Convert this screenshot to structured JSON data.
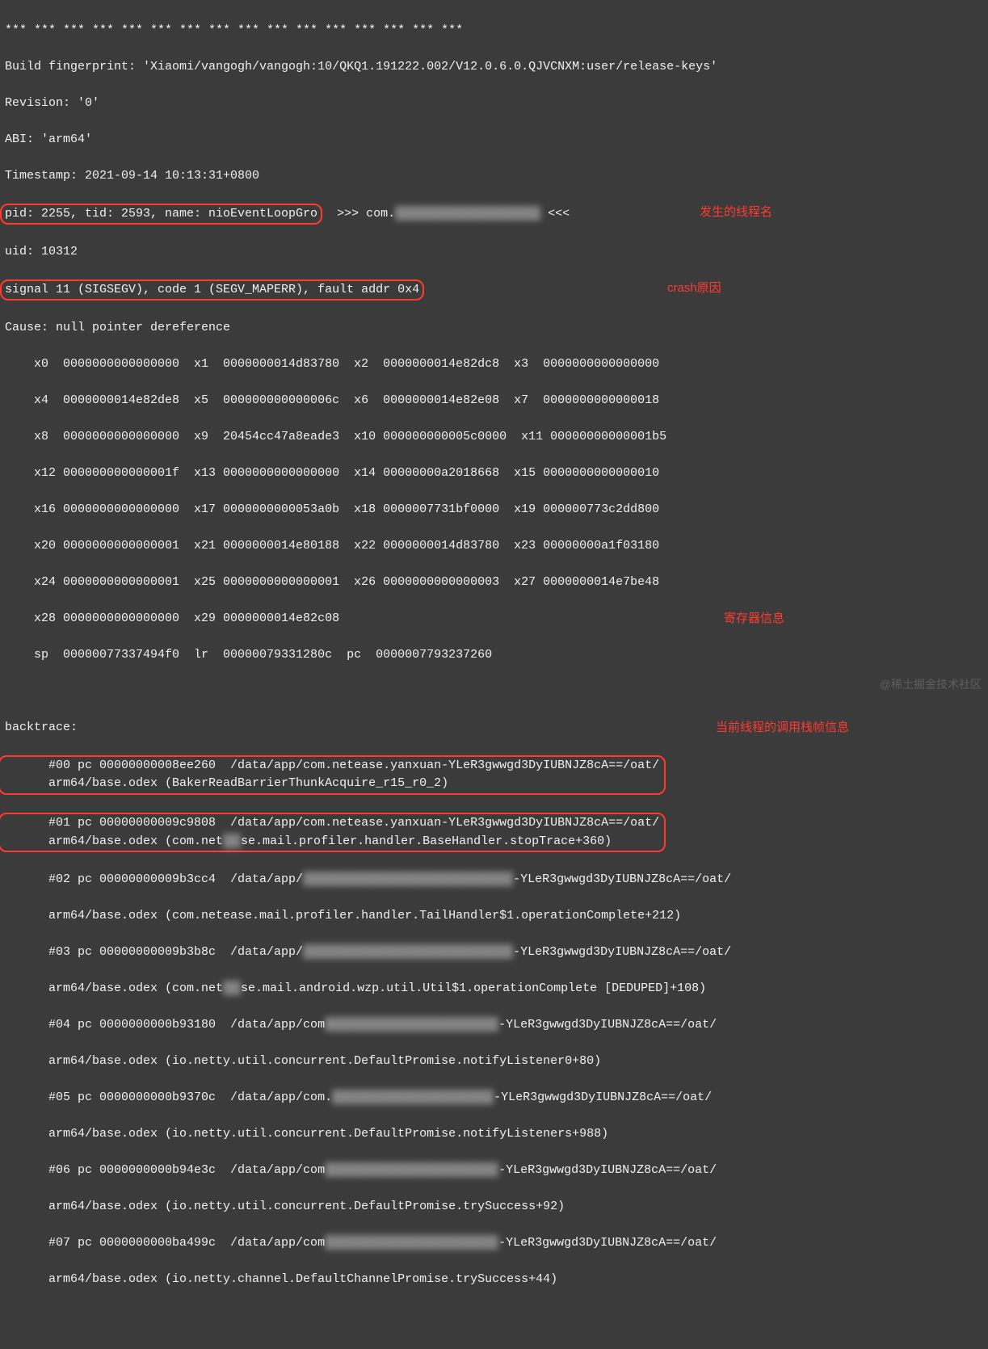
{
  "annotations": {
    "thread_name": "发生的线程名",
    "crash_reason": "crash原因",
    "registers": "寄存器信息",
    "backtrace": "当前线程的调用栈帧信息"
  },
  "watermark": "@稀土掘金技术社区",
  "lines": {
    "stars": "*** *** *** *** *** *** *** *** *** *** *** *** *** *** *** ***",
    "bf": "Build fingerprint: 'Xiaomi/vangogh/vangogh:10/QKQ1.191222.002/V12.0.6.0.QJVCNXM:user/release-keys'",
    "rev": "Revision: '0'",
    "abi": "ABI: 'arm64'",
    "ts": "Timestamp: 2021-09-14 10:13:31+0800",
    "pid": "pid: 2255, tid: 2593, name: nioEventLoopGro",
    "pid_after1": "  >>> com.",
    "pid_after2": " <<<",
    "uid": "uid: 10312",
    "sig": "signal 11 (SIGSEGV), code 1 (SEGV_MAPERR), fault addr 0x4",
    "cause": "Cause: null pointer dereference",
    "r0": "    x0  0000000000000000  x1  0000000014d83780  x2  0000000014e82dc8  x3  0000000000000000",
    "r1": "    x4  0000000014e82de8  x5  000000000000006c  x6  0000000014e82e08  x7  0000000000000018",
    "r2": "    x8  0000000000000000  x9  20454cc47a8eade3  x10 000000000005c0000  x11 00000000000001b5",
    "r3": "    x12 000000000000001f  x13 0000000000000000  x14 00000000a2018668  x15 0000000000000010",
    "r4": "    x16 0000000000000000  x17 0000000000053a0b  x18 0000007731bf0000  x19 000000773c2dd800",
    "r5": "    x20 0000000000000001  x21 0000000014e80188  x22 0000000014d83780  x23 00000000a1f03180",
    "r6": "    x24 0000000000000001  x25 0000000000000001  x26 0000000000000003  x27 0000000014e7be48",
    "r7": "    x28 0000000000000000  x29 0000000014e82c08",
    "r8": "    sp  00000077337494f0  lr  00000079331280c  pc  0000007793237260",
    "bt_header": "backtrace:",
    "bt00a": "      #00 pc 00000000008ee260  /data/app/com.netease.yanxuan-YLeR3gwwgd3DyIUBNJZ8cA==/oat/",
    "bt00b": "      arm64/base.odex (BakerReadBarrierThunkAcquire_r15_r0_2)",
    "bt01a": "      #01 pc 00000000009c9808  /data/app/com.netease.yanxuan-YLeR3gwwgd3DyIUBNJZ8cA==/oat/",
    "bt01b_pre": "      arm64/base.odex (com.net",
    "bt01b_post": "se.mail.profiler.handler.BaseHandler.stopTrace+360)",
    "bt02a_pre": "      #02 pc 00000000009b3cc4  /data/app/",
    "bt02a_post": "-YLeR3gwwgd3DyIUBNJZ8cA==/oat/",
    "bt02b": "      arm64/base.odex (com.netease.mail.profiler.handler.TailHandler$1.operationComplete+212)",
    "bt03a_pre": "      #03 pc 00000000009b3b8c  /data/app/",
    "bt03a_post": "-YLeR3gwwgd3DyIUBNJZ8cA==/oat/",
    "bt03b_pre": "      arm64/base.odex (com.net",
    "bt03b_post": "se.mail.android.wzp.util.Util$1.operationComplete [DEDUPED]+108)",
    "bt04a_pre": "      #04 pc 0000000000b93180  /data/app/com",
    "bt04a_post": "-YLeR3gwwgd3DyIUBNJZ8cA==/oat/",
    "bt04b": "      arm64/base.odex (io.netty.util.concurrent.DefaultPromise.notifyListener0+80)",
    "bt05a_pre": "      #05 pc 0000000000b9370c  /data/app/com.",
    "bt05a_post": "-YLeR3gwwgd3DyIUBNJZ8cA==/oat/",
    "bt05b": "      arm64/base.odex (io.netty.util.concurrent.DefaultPromise.notifyListeners+988)",
    "bt06a_pre": "      #06 pc 0000000000b94e3c  /data/app/com",
    "bt06a_post": "-YLeR3gwwgd3DyIUBNJZ8cA==/oat/",
    "bt06b": "      arm64/base.odex (io.netty.util.concurrent.DefaultPromise.trySuccess+92)",
    "bt07a_pre": "      #07 pc 0000000000ba499c  /data/app/com",
    "bt07a_post": "-YLeR3gwwgd3DyIUBNJZ8cA==/oat/",
    "bt07b": "      arm64/base.odex (io.netty.channel.DefaultChannelPromise.trySuccess+44)"
  }
}
